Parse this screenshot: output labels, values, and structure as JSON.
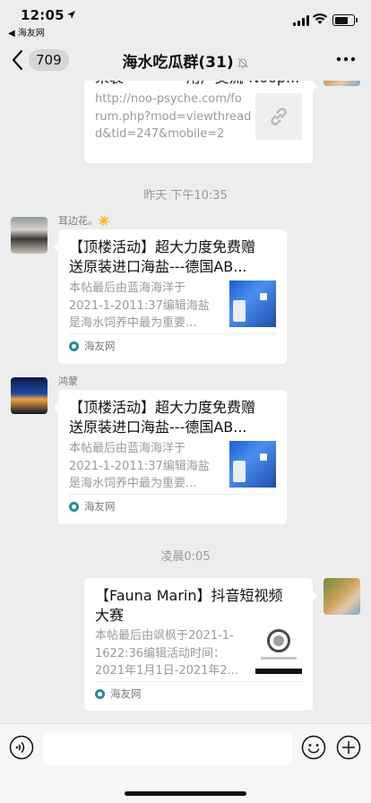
{
  "status_bar": {
    "time": "12:05",
    "back_app": "◀ 海友网",
    "battery_level": 0.75
  },
  "nav": {
    "unread_count": "709",
    "title": "海水吃瓜群(31)",
    "icons": {
      "back": "chevron-left-icon",
      "mute": "bell-off-icon",
      "more": "more-dots-icon"
    }
  },
  "messages": [
    {
      "type": "link-card",
      "side": "right",
      "title": "来袭~~~~ - 用户交流-Noop...",
      "desc_lines": [
        "http://noo-psyche.com/fo",
        "rum.php?mod=viewthread",
        "d&tid=247&mobile=2"
      ],
      "thumb_icon": "link-icon"
    },
    {
      "type": "time",
      "text": "昨天 下午10:35"
    },
    {
      "type": "link-card",
      "side": "left",
      "sender": "耳边花。☀️",
      "title_lines": [
        "【顶楼活动】超大力度免费赠",
        "送原装进口海盐---德国AB..."
      ],
      "desc_lines": [
        "本帖最后由蓝海海洋于",
        "2021-1-2011:37编辑海盐",
        "是海水饲养中最为重要..."
      ],
      "source": "海友网"
    },
    {
      "type": "link-card",
      "side": "left",
      "sender": "鸿蒙",
      "title_lines": [
        "【顶楼活动】超大力度免费赠",
        "送原装进口海盐---德国AB..."
      ],
      "desc_lines": [
        "本帖最后由蓝海海洋于",
        "2021-1-2011:37编辑海盐",
        "是海水饲养中最为重要..."
      ],
      "source": "海友网"
    },
    {
      "type": "time",
      "text": "凌晨0:05"
    },
    {
      "type": "link-card",
      "side": "right",
      "title_lines": [
        "【Fauna Marin】抖音短视频",
        "大赛"
      ],
      "desc_lines": [
        "本帖最后由飒枫于2021-1-",
        "1622:36编辑活动时间：",
        "2021年1月1日-2021年2..."
      ],
      "source": "海友网"
    }
  ],
  "input_bar": {
    "placeholder": "",
    "icons": {
      "voice": "voice-icon",
      "emoji": "emoji-icon",
      "plus": "plus-icon"
    }
  },
  "colors": {
    "background": "#ededed",
    "card": "#ffffff",
    "muted_text": "#9b9b9b"
  }
}
